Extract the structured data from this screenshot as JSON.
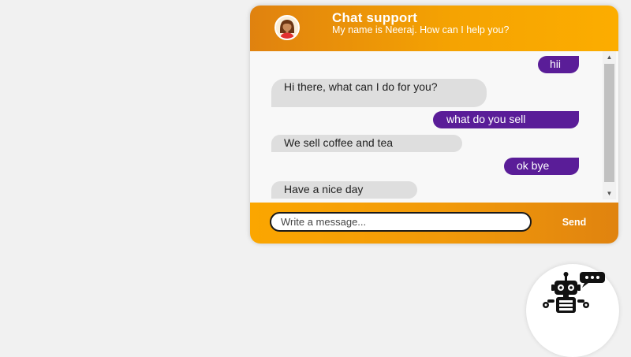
{
  "header": {
    "title": "Chat support",
    "subtitle": "My name is Neeraj. How can I help you?",
    "avatar_icon": "woman-avatar-icon"
  },
  "messages": [
    {
      "sender": "user",
      "text": "hii"
    },
    {
      "sender": "bot",
      "text": "Hi there, what can I do for you?"
    },
    {
      "sender": "user",
      "text": "what do you sell"
    },
    {
      "sender": "bot",
      "text": "We sell coffee and tea"
    },
    {
      "sender": "user",
      "text": "ok bye"
    },
    {
      "sender": "bot",
      "text": "Have a nice day"
    }
  ],
  "footer": {
    "input_placeholder": "Write a message...",
    "send_label": "Send"
  },
  "launcher": {
    "icon": "robot-chat-icon"
  },
  "colors": {
    "header_orange": "#f5a302",
    "user_bubble": "#5a1d98",
    "bot_bubble": "#dedede",
    "page_background": "#f1f1f1"
  }
}
